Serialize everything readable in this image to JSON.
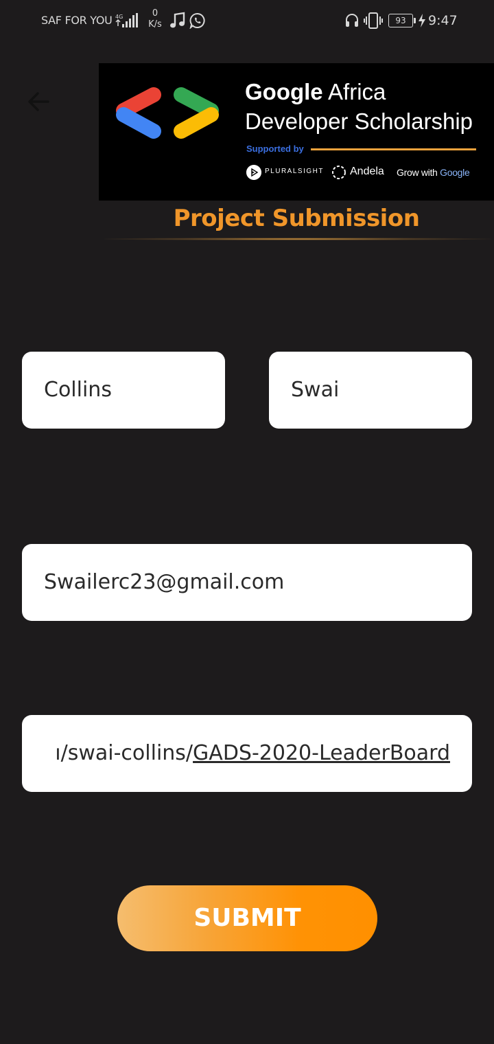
{
  "status_bar": {
    "carrier": "SAF FOR YOU",
    "network_type": "4G",
    "speed_value": "0",
    "speed_unit": "K/s",
    "battery_level": "93",
    "time": "9:47"
  },
  "banner": {
    "title_bold": "Google",
    "title_rest": " Africa",
    "title_line2": "Developer Scholarship",
    "supported_by": "Supported by",
    "sponsor_1": "PLURALSIGHT",
    "sponsor_2": "Andela",
    "sponsor_3_prefix": "Grow with ",
    "sponsor_3_brand": "Google",
    "google_colors": [
      "#4285f4",
      "#ea4335",
      "#fbbc05",
      "#34a853"
    ]
  },
  "page": {
    "title": "Project Submission",
    "title_color": "#f0962a"
  },
  "form": {
    "first_name": "Collins",
    "last_name": "Swai",
    "email": "Swailerc23@gmail.com",
    "project_link_plain": "ı/swai-collins/",
    "project_link_underlined": "GADS-2020-LeaderBoard"
  },
  "actions": {
    "submit_label": "SUBMIT",
    "submit_gradient": [
      "#f5bd6e",
      "#ff9000"
    ]
  },
  "icons": {
    "back": "arrow-left-icon",
    "music": "music-note-icon",
    "whatsapp": "whatsapp-icon",
    "headset": "headset-icon",
    "vibrate": "vibrate-icon",
    "charging": "charging-bolt-icon"
  }
}
